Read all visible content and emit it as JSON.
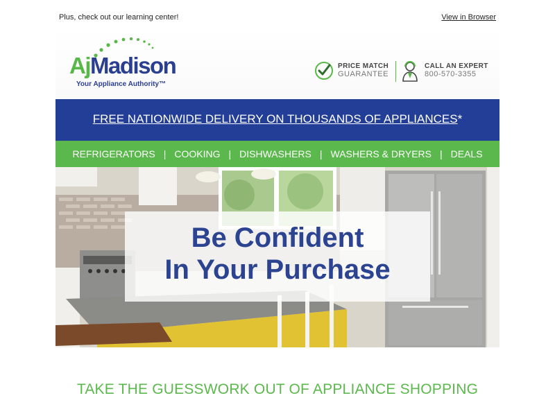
{
  "topbar": {
    "note": "Plus, check out our learning center!",
    "view_in_browser": "View in Browser"
  },
  "logo": {
    "part1": "Aj",
    "part2": "Madison",
    "tagline": "Your Appliance Authority™"
  },
  "header": {
    "price_match": {
      "line1": "PRICE MATCH",
      "line2": "GUARANTEE"
    },
    "expert": {
      "line1": "CALL AN EXPERT",
      "line2": "800-570-3355"
    }
  },
  "banner": {
    "text": "FREE NATIONWIDE DELIVERY ON THOUSANDS OF APPLIANCES",
    "suffix": "*"
  },
  "nav": {
    "items": [
      "REFRIGERATORS",
      "COOKING",
      "DISHWASHERS",
      "WASHERS & DRYERS",
      "DEALS"
    ],
    "separator": "|"
  },
  "hero": {
    "line1": "Be Confident",
    "line2": "In Your Purchase"
  },
  "tagline": "TAKE THE GUESSWORK OUT OF APPLIANCE SHOPPING",
  "colors": {
    "brand_blue": "#233e96",
    "brand_green": "#5bb84c",
    "hero_text": "#2b4390"
  }
}
